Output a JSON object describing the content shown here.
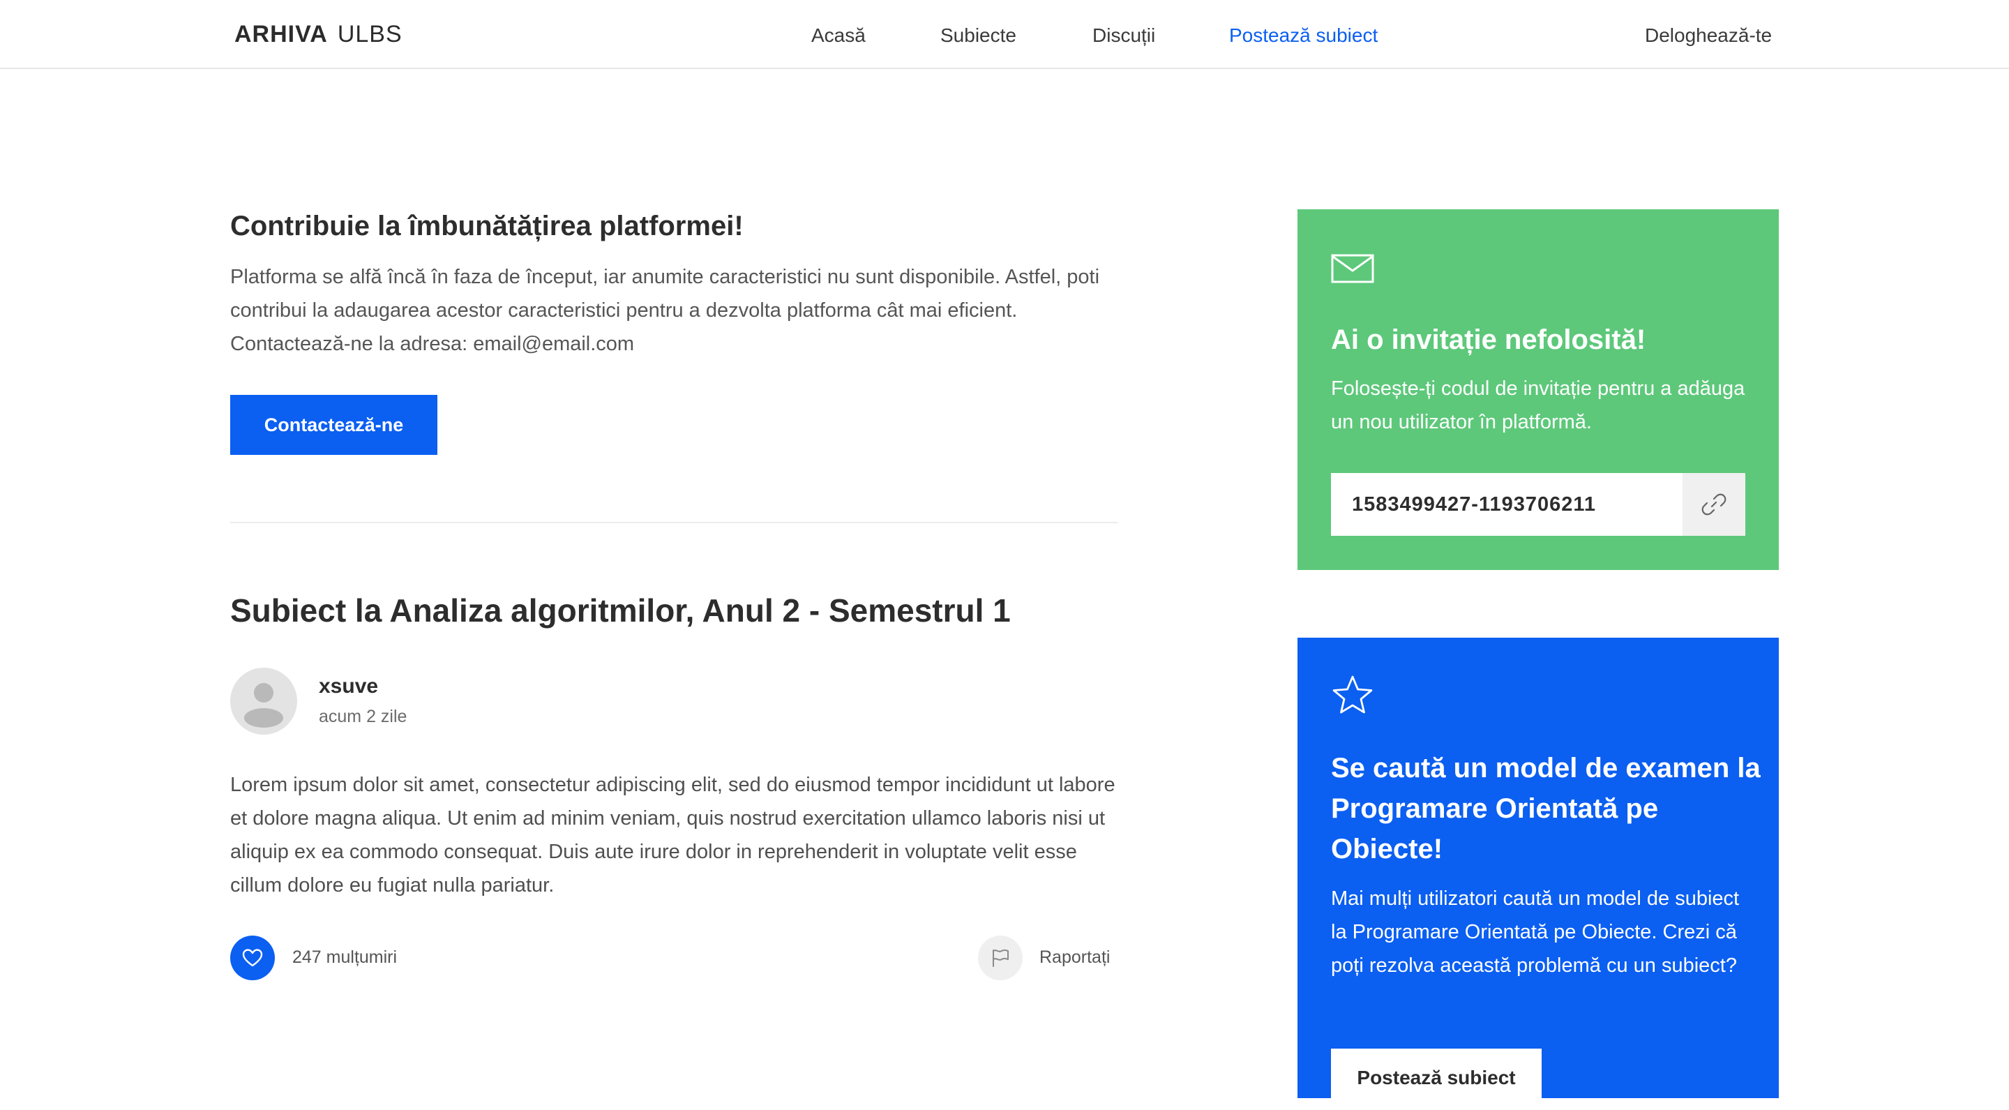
{
  "brand": {
    "strong": "ARHIVA",
    "light": "ULBS"
  },
  "nav": {
    "items": [
      {
        "label": "Acasă"
      },
      {
        "label": "Subiecte"
      },
      {
        "label": "Discuții"
      },
      {
        "label": "Postează subiect",
        "active": true
      }
    ],
    "logout": "Deloghează-te"
  },
  "contribute": {
    "title": "Contribuie la îmbunătățirea platformei!",
    "text": "Platforma se alfă încă în faza de început, iar anumite caracteristici nu sunt disponibile. Astfel, poti contribui la adaugarea acestor caracteristici pentru a dezvolta platforma cât mai eficient. Contactează-ne la adresa: email@email.com",
    "button": "Contactează-ne"
  },
  "post": {
    "title": "Subiect la Analiza algoritmilor, Anul 2 - Semestrul 1",
    "author": "xsuve",
    "time": "acum 2 zile",
    "body": "Lorem ipsum dolor sit amet, consectetur adipiscing elit, sed do eiusmod tempor incididunt ut labore et dolore magna aliqua. Ut enim ad minim veniam, quis nostrud exercitation ullamco laboris nisi ut aliquip ex ea commodo consequat. Duis aute irure dolor in reprehenderit in voluptate velit esse cillum dolore eu fugiat nulla pariatur.",
    "likes": "247 mulțumiri",
    "report": "Raportați"
  },
  "invite_card": {
    "icon": "envelope-icon",
    "title": "Ai o invitație nefolosită!",
    "text": "Folosește-ți codul de invitație pentru a adăuga un nou utilizator în platformă.",
    "code": "1583499427-1193706211",
    "color": "#5dc87a"
  },
  "request_card": {
    "icon": "star-icon",
    "title": "Se caută un model de examen la Programare Orientată pe Obiecte!",
    "text": "Mai mulți utilizatori caută un model de subiect la Programare Orientată pe Obiecte. Crezi că poți rezolva această problemă cu un subiect?",
    "button": "Postează subiect",
    "color": "#0b5ff1"
  },
  "colors": {
    "accent": "#0b5ff1",
    "success": "#5dc87a"
  }
}
